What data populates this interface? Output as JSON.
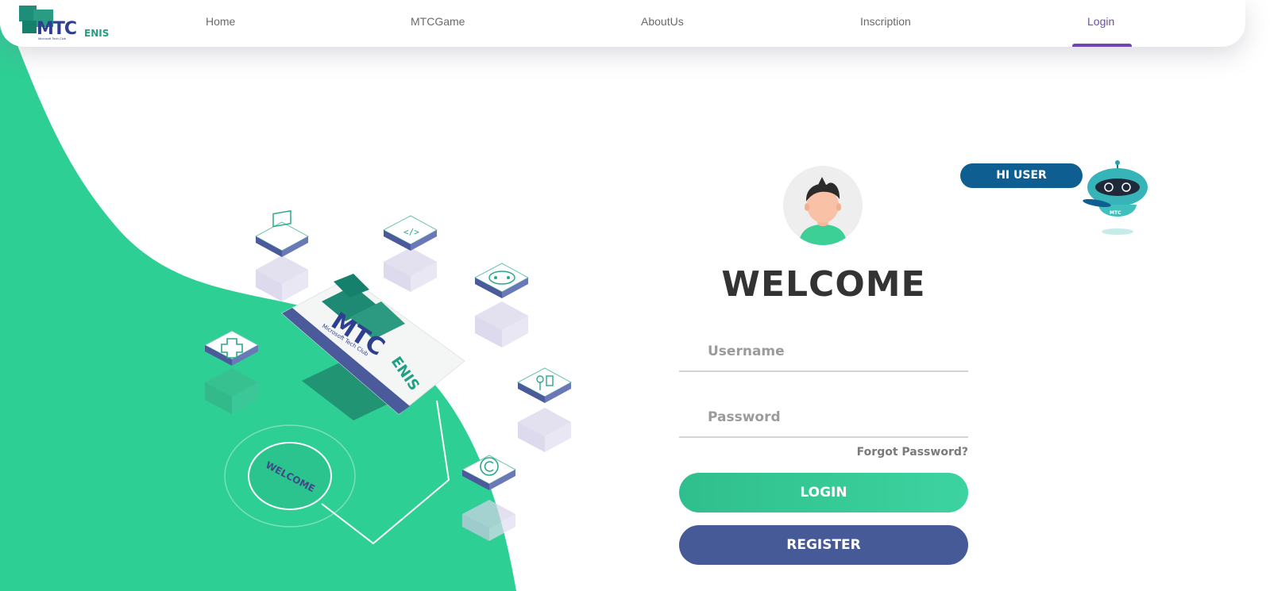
{
  "app": {
    "logo_text": "MTC",
    "logo_suffix": "ENIS",
    "logo_subtitle": "Microsoft Tech Club"
  },
  "nav": {
    "items": [
      {
        "label": "Home",
        "active": false
      },
      {
        "label": "MTCGame",
        "active": false
      },
      {
        "label": "AboutUs",
        "active": false
      },
      {
        "label": "Inscription",
        "active": false
      },
      {
        "label": "Login",
        "active": true
      }
    ]
  },
  "illustration": {
    "card_brand": "MTC",
    "card_suffix": "ENIS",
    "card_subtitle": "Microsoft Tech Club",
    "badge_text": "WELCOME"
  },
  "robot": {
    "greeting": "HI USER",
    "body_text": "MTC"
  },
  "form": {
    "title": "WELCOME",
    "username_placeholder": "Username",
    "password_placeholder": "Password",
    "forgot_label": "Forgot Password?",
    "login_label": "LOGIN",
    "register_label": "REGISTER"
  },
  "colors": {
    "accent_green": "#2ecf95",
    "nav_active": "#6f46b8",
    "register_blue": "#475a98",
    "bubble_blue": "#0f5e92",
    "card_stripe": "#4a5a9a"
  },
  "icons": [
    "avatar-icon",
    "robot-icon",
    "ui-layout-icon",
    "code-icon",
    "gamepad-icon",
    "medical-cross-icon",
    "network-icon",
    "copyright-icon"
  ]
}
